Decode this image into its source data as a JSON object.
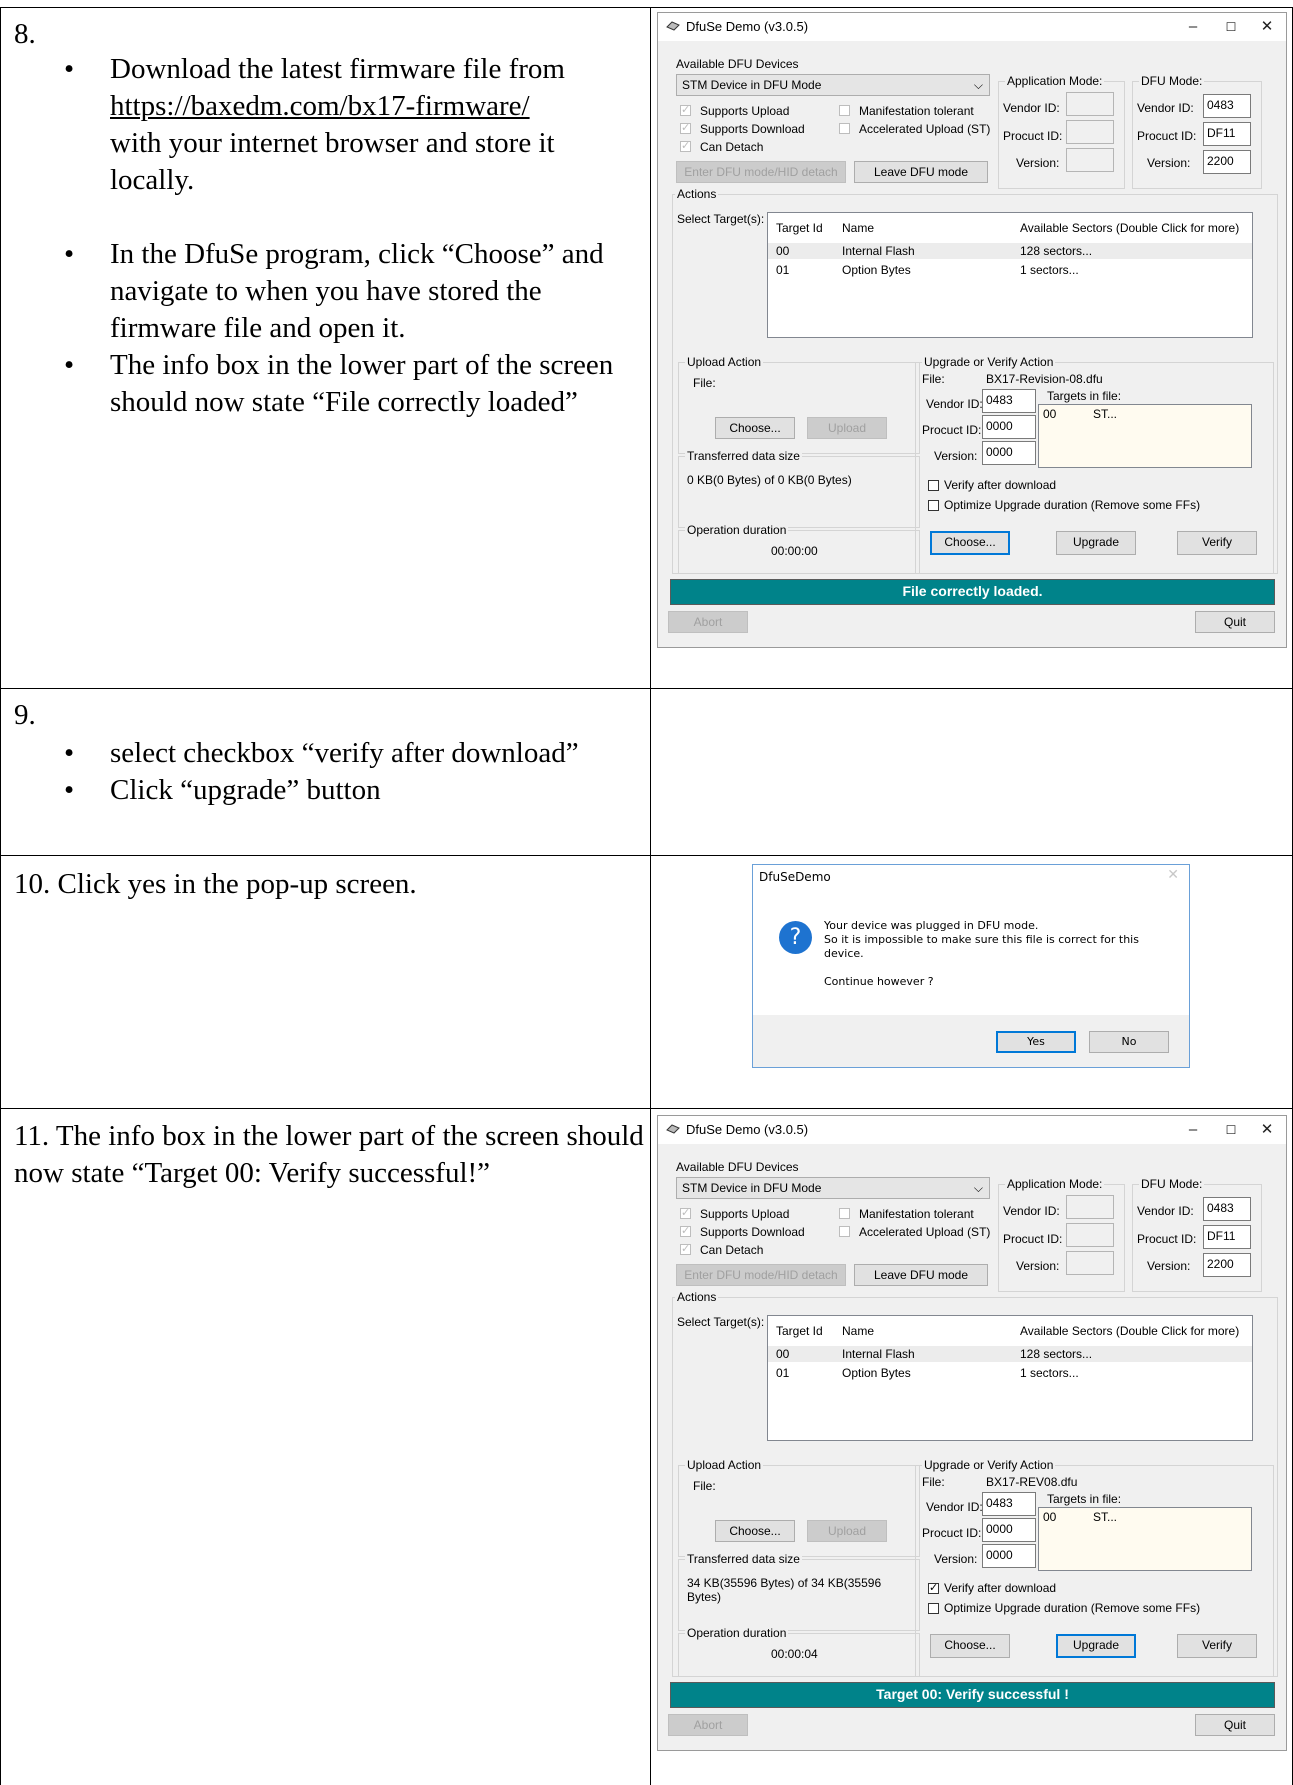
{
  "rows": [
    {
      "num": "8.",
      "bullet": "•",
      "bullets": [
        {
          "pre": "Download the latest firmware file from",
          "link": "https://baxedm.com/bx17-firmware/",
          "post": "with your internet browser and store it locally."
        },
        {
          "text": "In the DfuSe program, click “Choose” and navigate to when you have stored the firmware file and open it."
        },
        {
          "text": "The info box in the lower part of the screen should now state “File correctly loaded”"
        }
      ]
    },
    {
      "num": "9.",
      "bullets": [
        "select checkbox “verify after download”",
        "Click “upgrade” button"
      ]
    },
    {
      "text": "10. Click yes in the pop-up screen."
    },
    {
      "text": "11. The info box in the lower part of the screen should now state “Target 00: Verify successful!”"
    }
  ],
  "dfuse_common": {
    "title": "DfuSe Demo (v3.0.5)",
    "min_glyph": "–",
    "max_glyph": "☐",
    "close_glyph": "✕",
    "available_devices": "Available DFU Devices",
    "device": "STM Device in DFU Mode",
    "combo_arrow": "⌵",
    "supports_upload": "Supports Upload",
    "supports_download": "Supports Download",
    "can_detach": "Can Detach",
    "manifestation_tolerant": "Manifestation tolerant",
    "accelerated_upload": "Accelerated Upload (ST)",
    "enter_dfu": "Enter DFU mode/HID detach",
    "leave_dfu": "Leave DFU mode",
    "application_mode": "Application Mode:",
    "dfu_mode": "DFU Mode:",
    "vendor_id_label": "Vendor ID:",
    "product_id_label": "Procuct ID:",
    "version_label": "Version:",
    "dfu_vendor_id": "0483",
    "dfu_product_id": "DF11",
    "dfu_version": "2200",
    "actions": "Actions",
    "select_targets": "Select Target(s):",
    "col_target_id": "Target Id",
    "col_name": "Name",
    "col_sectors": "Available Sectors (Double Click for more)",
    "targets": [
      {
        "id": "00",
        "name": "Internal Flash",
        "sectors": "128 sectors..."
      },
      {
        "id": "01",
        "name": "Option Bytes",
        "sectors": "1 sectors..."
      }
    ],
    "upload_action": "Upload Action",
    "file_label": "File:",
    "choose": "Choose...",
    "upload": "Upload",
    "transferred": "Transferred data size",
    "operation_duration": "Operation duration",
    "upgrade_verify": "Upgrade or Verify Action",
    "targets_in_file": "Targets in file:",
    "tif_id": "00",
    "tif_name": "ST...",
    "up_vendor_id": "0483",
    "up_product_id": "0000",
    "up_version": "0000",
    "verify_after_download": "Verify after download",
    "optimize": "Optimize Upgrade duration (Remove some FFs)",
    "upgrade": "Upgrade",
    "verify": "Verify",
    "abort": "Abort",
    "quit": "Quit",
    "check_glyph": "✓"
  },
  "dfuse_1": {
    "file_name": "BX17-Revision-08.dfu",
    "transferred_value": "0 KB(0 Bytes) of 0 KB(0 Bytes)",
    "duration": "00:00:00",
    "status": "File correctly loaded."
  },
  "dfuse_2": {
    "file_name": "BX17-REV08.dfu",
    "transferred_value": "34 KB(35596 Bytes) of 34 KB(35596 Bytes)",
    "duration": "00:00:04",
    "status": "Target 00: Verify successful !"
  },
  "dialog": {
    "title": "DfuSeDemo",
    "close_glyph": "✕",
    "icon_glyph": "?",
    "line1": "Your device was plugged in DFU mode.",
    "line2": "So it is impossible to make sure this file is correct for this device.",
    "line3": "Continue however ?",
    "yes": "Yes",
    "no": "No"
  },
  "colors": {
    "status_bar": "#00838a",
    "dialog_icon": "#1e73d0",
    "focus": "#0078d7"
  }
}
